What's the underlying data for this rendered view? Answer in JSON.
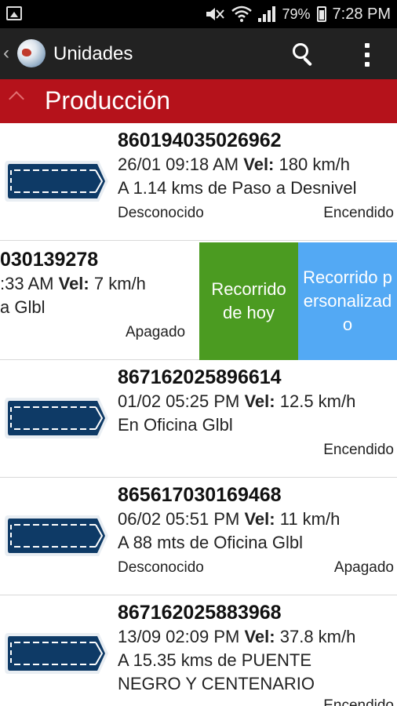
{
  "status_bar": {
    "battery": "79%",
    "time": "7:28 PM",
    "icons": [
      "gallery-icon",
      "mute-icon",
      "wifi-icon",
      "signal-icon",
      "battery-icon"
    ]
  },
  "action_bar": {
    "title": "Unidades",
    "icons": [
      "back-chevron-icon",
      "globe-logo-icon",
      "search-icon",
      "overflow-menu-icon"
    ]
  },
  "section": {
    "title": "Producción"
  },
  "units": [
    {
      "id": "860194035026962",
      "datetime": "26/01 09:18 AM",
      "vel_label": "Vel:",
      "speed": "180 km/h",
      "location_lines": [
        "A 1.14 kms de Paso a Desnivel"
      ],
      "status": "Desconocido",
      "engine": "Encendido"
    },
    {
      "id_partial": "030139278",
      "datetime_partial": ":33 AM",
      "vel_label": "Vel:",
      "speed": "7 km/h",
      "location_partial": "a Glbl",
      "engine": "Apagado",
      "actions": [
        "Recorrido de hoy",
        "Recorrido personalizado"
      ]
    },
    {
      "id": "867162025896614",
      "datetime": "01/02 05:25 PM",
      "vel_label": "Vel:",
      "speed": "12.5 km/h",
      "location_lines": [
        "En Oficina Glbl"
      ],
      "status": "",
      "engine": "Encendido"
    },
    {
      "id": "865617030169468",
      "datetime": "06/02 05:51 PM",
      "vel_label": "Vel:",
      "speed": "11 km/h",
      "location_lines": [
        "A 88 mts de Oficina Glbl"
      ],
      "status": "Desconocido",
      "engine": "Apagado"
    },
    {
      "id": "867162025883968",
      "datetime": "13/09 02:09 PM",
      "vel_label": "Vel:",
      "speed": "37.8 km/h",
      "location_lines": [
        "A 15.35 kms de PUENTE",
        "NEGRO Y CENTENARIO"
      ],
      "status": "",
      "engine": "Encendido"
    }
  ],
  "colors": {
    "action_bar": "#222222",
    "section_header": "#b5121b",
    "action_green": "#4b9b21",
    "action_blue": "#53a9f4",
    "truck_fill": "#0e3a66"
  }
}
